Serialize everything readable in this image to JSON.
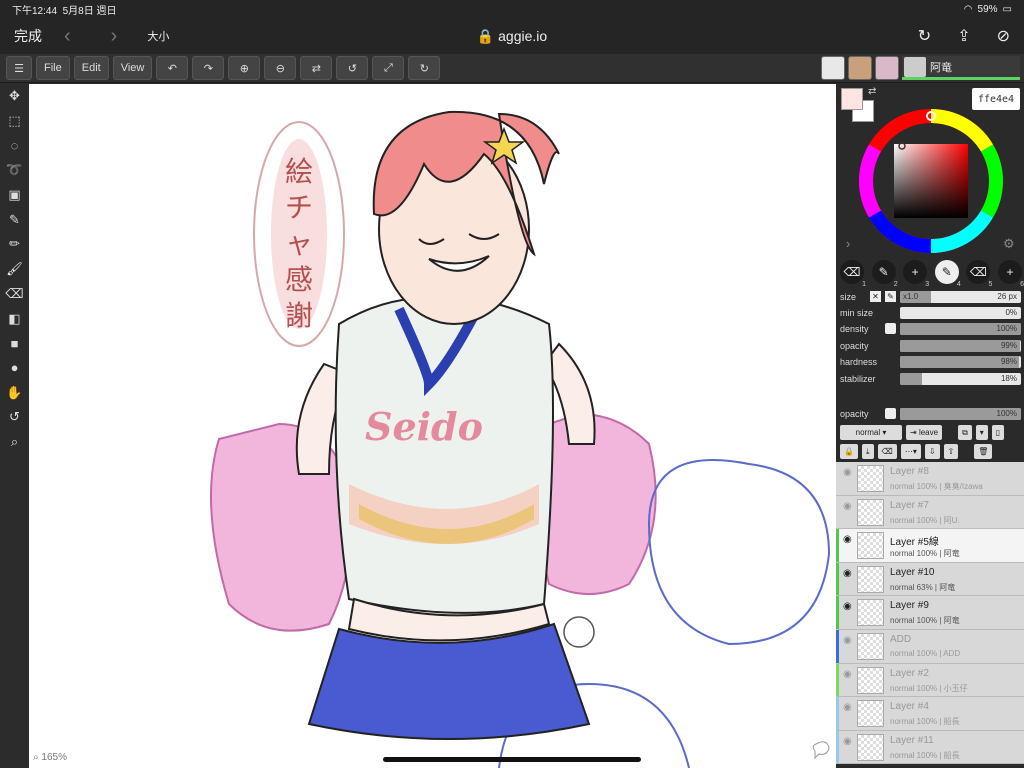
{
  "status": {
    "time": "下午12:44",
    "date": "5月8日 週日",
    "battery": "59%"
  },
  "browser": {
    "done": "完成",
    "back": "‹",
    "forward": "›",
    "text_size": "大小",
    "url": "aggie.io"
  },
  "toolbar": {
    "file": "File",
    "edit": "Edit",
    "view": "View"
  },
  "users": {
    "current_name": "阿竜"
  },
  "canvas": {
    "zoom": "165%",
    "bubble_text": "絵チャ感謝",
    "shirt_text": "Seido"
  },
  "color": {
    "hex": "ffe4e4",
    "primary": "#ffe4e4",
    "secondary": "#ffffff"
  },
  "brushes": [
    {
      "icon": "eraser-icon",
      "num": "1"
    },
    {
      "icon": "brush-icon",
      "num": "2"
    },
    {
      "icon": "plus-icon",
      "num": "3"
    },
    {
      "icon": "brush-icon",
      "num": "4"
    },
    {
      "icon": "eraser-icon",
      "num": "5"
    },
    {
      "icon": "plus-icon",
      "num": "6"
    }
  ],
  "settings": {
    "size_label": "size",
    "size_mult": "x1.0",
    "size_value": "26 px",
    "size_level": 0.26,
    "min_size_label": "min size",
    "min_size_value": "0%",
    "min_size_level": 0.0,
    "density_label": "density",
    "density_value": "100%",
    "density_level": 1.0,
    "opacity_label": "opacity",
    "opacity_value": "99%",
    "opacity_level": 0.99,
    "hardness_label": "hardness",
    "hardness_value": "98%",
    "hardness_level": 0.98,
    "stabilizer_label": "stabilizer",
    "stabilizer_value": "18%",
    "stabilizer_level": 0.18,
    "layer_opacity_label": "opacity",
    "layer_opacity_value": "100%",
    "layer_opacity_level": 1.0
  },
  "layer_controls": {
    "blend": "normal ▾",
    "leave": "leave"
  },
  "layers": [
    {
      "name": "Layer #8",
      "info": "normal 100% | 臭臭/Izawa",
      "visible": false,
      "stripe": ""
    },
    {
      "name": "Layer #7",
      "info": "normal 100% | 阿U.",
      "visible": false,
      "stripe": ""
    },
    {
      "name": "Layer #5線",
      "info": "normal 100% | 阿竜",
      "visible": true,
      "selected": true,
      "stripe": "#4ec94e"
    },
    {
      "name": "Layer #10",
      "info": "normal 63% | 阿竜",
      "visible": true,
      "stripe": "#4ec94e"
    },
    {
      "name": "Layer #9",
      "info": "normal 100% | 阿竜",
      "visible": true,
      "stripe": "#4ec94e"
    },
    {
      "name": "ADD",
      "info": "normal 100% | ADD",
      "visible": false,
      "stripe": "#3a6fd8"
    },
    {
      "name": "Layer #2",
      "info": "normal 100% | 小玉仔",
      "visible": false,
      "stripe": "#7ed957"
    },
    {
      "name": "Layer #4",
      "info": "normal 100% | 船長",
      "visible": false,
      "stripe": "#9ac8e8"
    },
    {
      "name": "Layer #11",
      "info": "normal 100% | 船長",
      "visible": false,
      "stripe": "#9ac8e8"
    }
  ]
}
